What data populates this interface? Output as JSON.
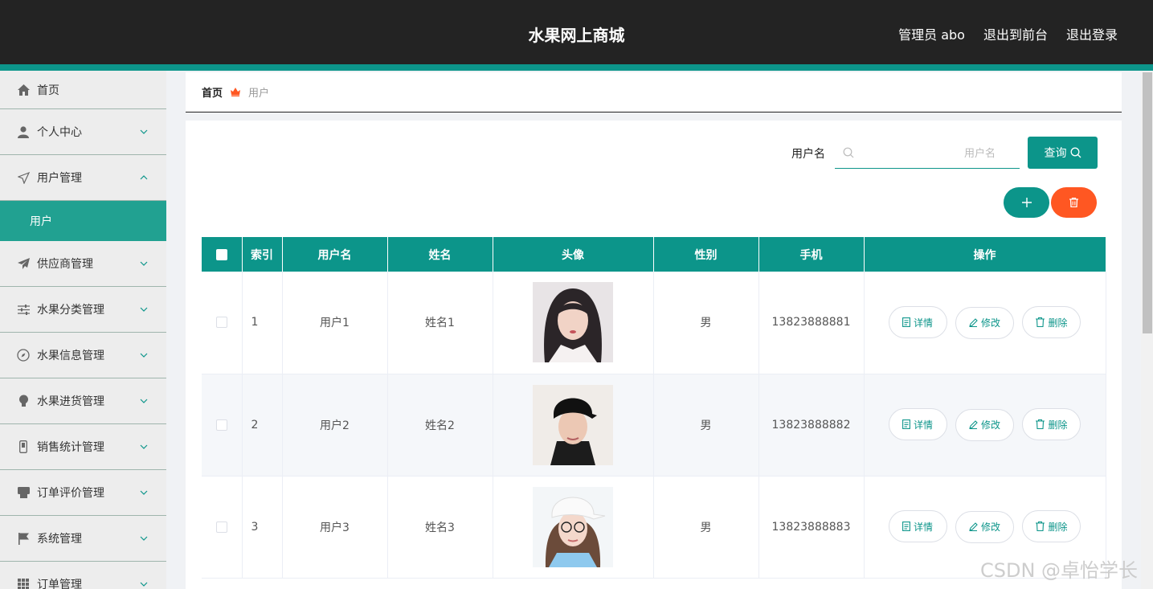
{
  "header": {
    "title": "水果网上商城",
    "admin": "管理员 abo",
    "to_front": "退出到前台",
    "logout": "退出登录"
  },
  "sidebar": {
    "items": [
      {
        "label": "首页",
        "icon": "home-icon"
      },
      {
        "label": "个人中心",
        "icon": "user-icon"
      },
      {
        "label": "用户管理",
        "icon": "send-icon"
      },
      {
        "label": "供应商管理",
        "icon": "plane-icon"
      },
      {
        "label": "水果分类管理",
        "icon": "sliders-icon"
      },
      {
        "label": "水果信息管理",
        "icon": "compass-icon"
      },
      {
        "label": "水果进货管理",
        "icon": "bulb-icon"
      },
      {
        "label": "销售统计管理",
        "icon": "phone-icon"
      },
      {
        "label": "订单评价管理",
        "icon": "printer-icon"
      },
      {
        "label": "系统管理",
        "icon": "flag-icon"
      },
      {
        "label": "订单管理",
        "icon": "grid-icon"
      }
    ],
    "active_sub": "用户"
  },
  "breadcrumb": {
    "home": "首页",
    "current": "用户"
  },
  "search": {
    "label": "用户名",
    "placeholder": "用户名",
    "value": "",
    "button": "查询"
  },
  "table": {
    "headers": [
      "索引",
      "用户名",
      "姓名",
      "头像",
      "性别",
      "手机",
      "操作"
    ],
    "rows": [
      {
        "index": "1",
        "username": "用户1",
        "name": "姓名1",
        "gender": "男",
        "phone": "13823888881"
      },
      {
        "index": "2",
        "username": "用户2",
        "name": "姓名2",
        "gender": "男",
        "phone": "13823888882"
      },
      {
        "index": "3",
        "username": "用户3",
        "name": "姓名3",
        "gender": "男",
        "phone": "13823888883"
      }
    ],
    "actions": {
      "detail": "详情",
      "edit": "修改",
      "delete": "删除"
    }
  },
  "watermark": "CSDN @卓怡学长",
  "colors": {
    "accent": "#0c958a",
    "danger": "#ff5722",
    "topbar": "#232323",
    "active_menu": "#21a191"
  }
}
